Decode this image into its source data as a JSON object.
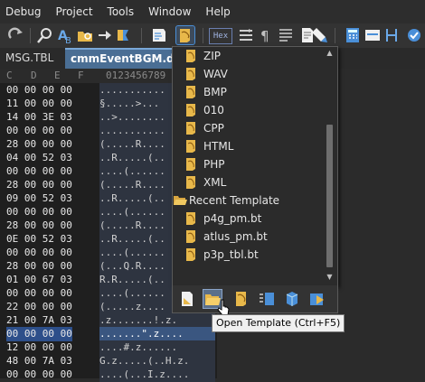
{
  "menubar": {
    "items": [
      "Debug",
      "Project",
      "Tools",
      "Window",
      "Help"
    ]
  },
  "toolbar": {
    "hex_label": "Hex"
  },
  "tabs": [
    {
      "label": "MSG.TBL"
    },
    {
      "label": "cmmEventBGM.dat"
    }
  ],
  "editor": {
    "column_header": {
      "hex_cols": [
        "C",
        "D",
        "E",
        "F"
      ],
      "ascii_cols": "0123456789"
    },
    "rows": [
      {
        "bytes": "00 00 00 00",
        "ascii": "..........."
      },
      {
        "bytes": "11 00 00 00",
        "ascii": "§.....>..."
      },
      {
        "bytes": "14 00 3E 03",
        "ascii": "..>........"
      },
      {
        "bytes": "00 00 00 00",
        "ascii": "..........."
      },
      {
        "bytes": "28 00 00 00",
        "ascii": "(.....R...."
      },
      {
        "bytes": "04 00 52 03",
        "ascii": "..R.....(.."
      },
      {
        "bytes": "00 00 00 00",
        "ascii": "....(......"
      },
      {
        "bytes": "28 00 00 00",
        "ascii": "(.....R...."
      },
      {
        "bytes": "09 00 52 03",
        "ascii": "..R.....(.."
      },
      {
        "bytes": "00 00 00 00",
        "ascii": "....(......"
      },
      {
        "bytes": "28 00 00 00",
        "ascii": "(.....R...."
      },
      {
        "bytes": "0E 00 52 03",
        "ascii": "..R.....(.."
      },
      {
        "bytes": "00 00 00 00",
        "ascii": "....(......"
      },
      {
        "bytes": "28 00 00 00",
        "ascii": "(...Q.R...."
      },
      {
        "bytes": "01 00 67 03",
        "ascii": "R.R.....(.."
      },
      {
        "bytes": "00 00 00 00",
        "ascii": "....(......"
      },
      {
        "bytes": "22 00 00 00",
        "ascii": "(.....z...."
      },
      {
        "bytes": "21 00 7A 03",
        "ascii": ".z.......!.z."
      },
      {
        "bytes": "00 00 00 00",
        "ascii": ".......\".z...."
      },
      {
        "bytes": "12 00 00 00",
        "ascii": "....#.z......"
      },
      {
        "bytes": "48 00 7A 03",
        "ascii": "G.z.....(..H.z."
      },
      {
        "bytes": "00 00 00 00",
        "ascii": "....(...I.z...."
      }
    ]
  },
  "dropdown": {
    "items": [
      {
        "label": "ZIP",
        "kind": "file"
      },
      {
        "label": "WAV",
        "kind": "file"
      },
      {
        "label": "BMP",
        "kind": "file"
      },
      {
        "label": "010",
        "kind": "file"
      },
      {
        "label": "CPP",
        "kind": "file"
      },
      {
        "label": "HTML",
        "kind": "file"
      },
      {
        "label": "PHP",
        "kind": "file"
      },
      {
        "label": "XML",
        "kind": "file"
      },
      {
        "label": "Recent Template",
        "kind": "folder"
      },
      {
        "label": "p4g_pm.bt",
        "kind": "file"
      },
      {
        "label": "atlus_pm.bt",
        "kind": "file"
      },
      {
        "label": "p3p_tbl.bt",
        "kind": "file"
      }
    ]
  },
  "tooltip": {
    "text": "Open Template (Ctrl+F5)"
  },
  "colors": {
    "accent": "#4a8fd8",
    "template_icon": "#e8b84a",
    "selection": "#2d4f8a"
  }
}
